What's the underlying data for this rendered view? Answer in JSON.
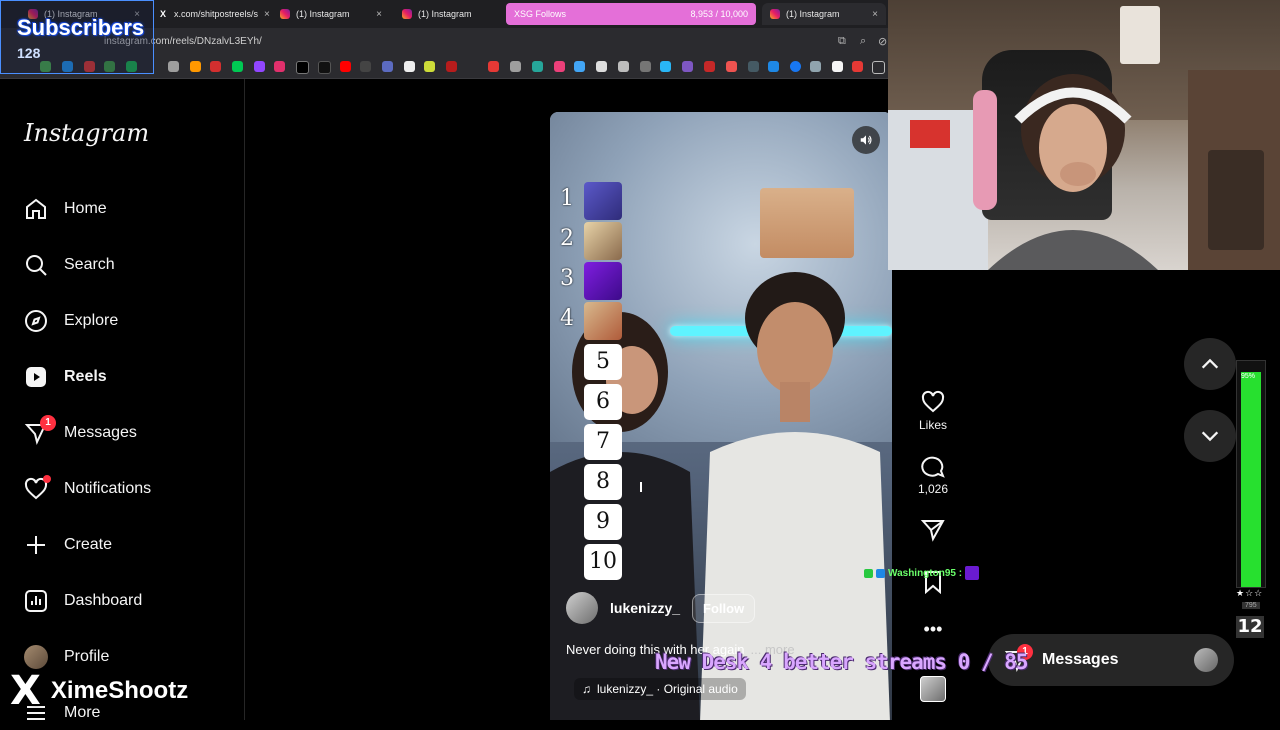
{
  "browser": {
    "tabs": [
      {
        "title": "(1) Instagram",
        "active": false
      },
      {
        "title": "x.com/shitpostreels/s",
        "active": false
      },
      {
        "title": "(1) Instagram",
        "active": false
      },
      {
        "title": "(1) Instagram",
        "active": false
      },
      {
        "title": "XSG Follows",
        "active": false,
        "progress_text": "8,953 / 10,000"
      },
      {
        "title": "(1) Instagram",
        "active": true
      }
    ],
    "close_glyph": "×",
    "url": "instagram.com/reels/DNzalvL3EYh/"
  },
  "overlay": {
    "subscribers_label": "Subscribers",
    "subscribers_count": "128",
    "x_handle": "XimeShootz",
    "x_logo": "X",
    "goal_text": "New Desk 4 better streams  0 / 85",
    "chat_user": "Washington95 :",
    "meter_percent": "95%",
    "meter_level": 0.95,
    "meter_stars": "★☆☆",
    "meter_small": "795",
    "meter_big": "12"
  },
  "sidebar": {
    "logo": "Instagram",
    "items": [
      {
        "label": "Home",
        "icon": "home-icon"
      },
      {
        "label": "Search",
        "icon": "search-icon"
      },
      {
        "label": "Explore",
        "icon": "compass-icon"
      },
      {
        "label": "Reels",
        "icon": "reels-icon",
        "active": true
      },
      {
        "label": "Messages",
        "icon": "messenger-icon",
        "badge": "1"
      },
      {
        "label": "Notifications",
        "icon": "heart-icon",
        "dot": true
      },
      {
        "label": "Create",
        "icon": "plus-icon"
      },
      {
        "label": "Dashboard",
        "icon": "dashboard-icon"
      },
      {
        "label": "Profile",
        "icon": "avatar"
      },
      {
        "label": "More",
        "icon": "menu-icon"
      }
    ]
  },
  "reel": {
    "username": "lukenizzy_",
    "follow_label": "Follow",
    "caption": "Never doing this with her again",
    "more_label": "... more",
    "audio": "lukenizzy_ · Original audio",
    "ranking_numbers": [
      "1",
      "2",
      "3",
      "4"
    ],
    "ranking_cards": [
      "5",
      "6",
      "7",
      "8",
      "9",
      "10"
    ],
    "actions": {
      "likes_label": "Likes",
      "comments_count": "1,026"
    }
  },
  "messages_pill": {
    "label": "Messages",
    "badge": "1"
  },
  "colors": {
    "accent_red": "#ff3040",
    "neon": "#5ff3ff",
    "meter_green": "#27e02f",
    "progress_pink": "#e46fd8"
  }
}
